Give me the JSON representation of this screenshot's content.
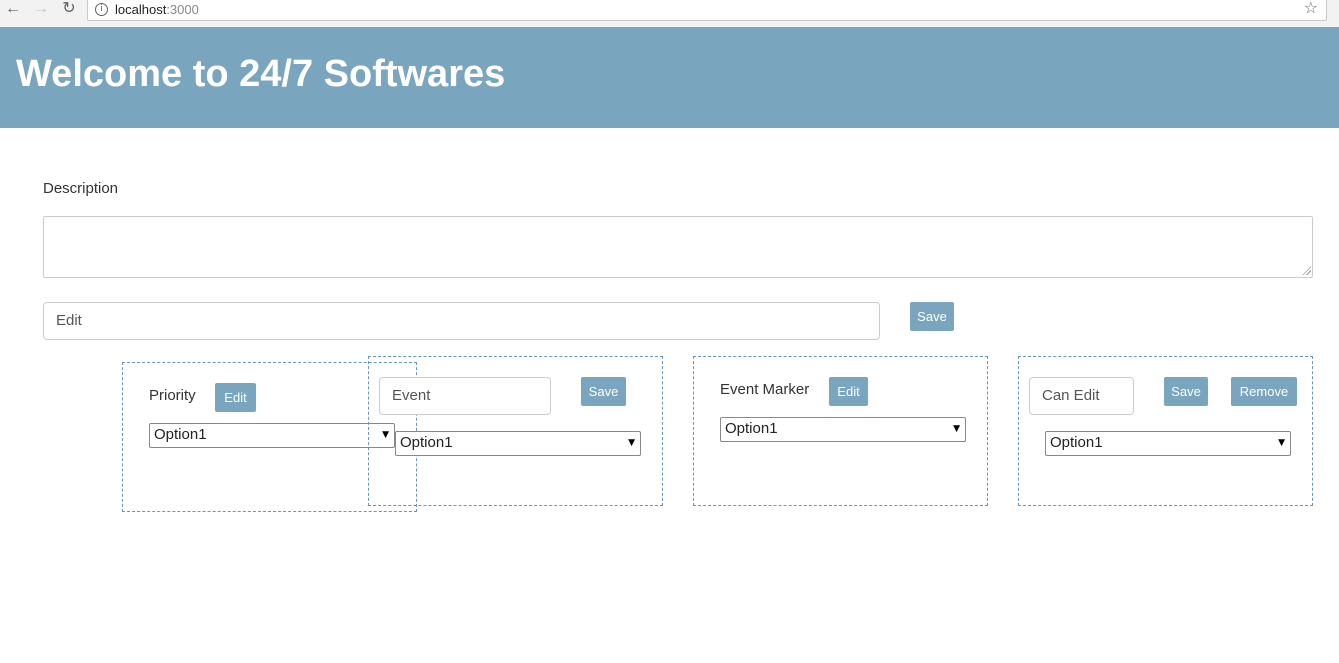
{
  "browser": {
    "url_host": "localhost",
    "url_port": ":3000",
    "back_icon": "←",
    "forward_icon": "→",
    "reload_icon": "↻",
    "info_icon": "i",
    "star_icon": "☆"
  },
  "header": {
    "title": "Welcome to 24/7 Softwares",
    "background": "#7aa5bf"
  },
  "form": {
    "description_label": "Description",
    "description_value": "",
    "edit_input_value": "Edit",
    "save_label": "Save"
  },
  "cards": {
    "priority": {
      "label": "Priority",
      "edit_label": "Edit",
      "select_value": "Option1"
    },
    "event": {
      "input_value": "Event",
      "save_label": "Save",
      "select_value": "Option1"
    },
    "event_marker": {
      "label": "Event Marker",
      "edit_label": "Edit",
      "select_value": "Option1"
    },
    "can_edit": {
      "input_value": "Can Edit",
      "save_label": "Save",
      "remove_label": "Remove",
      "select_value": "Option1"
    }
  },
  "select_arrow": "▼"
}
